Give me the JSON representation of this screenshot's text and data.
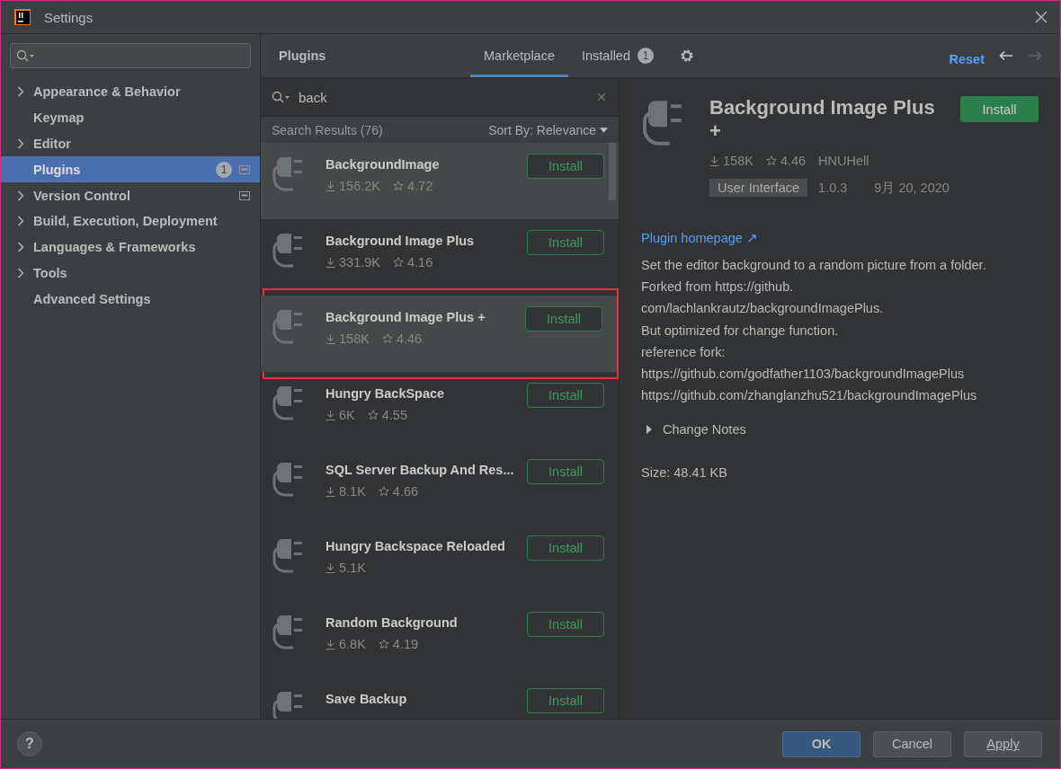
{
  "window": {
    "title": "Settings"
  },
  "sidebar": {
    "items": [
      {
        "label": "Appearance & Behavior",
        "expandable": true,
        "selected": false,
        "project_scope": false
      },
      {
        "label": "Keymap",
        "expandable": false,
        "selected": false,
        "project_scope": false
      },
      {
        "label": "Editor",
        "expandable": true,
        "selected": false,
        "project_scope": false
      },
      {
        "label": "Plugins",
        "expandable": false,
        "selected": true,
        "project_scope": true,
        "badge": "1"
      },
      {
        "label": "Version Control",
        "expandable": true,
        "selected": false,
        "project_scope": true
      },
      {
        "label": "Build, Execution, Deployment",
        "expandable": true,
        "selected": false,
        "project_scope": false
      },
      {
        "label": "Languages & Frameworks",
        "expandable": true,
        "selected": false,
        "project_scope": false
      },
      {
        "label": "Tools",
        "expandable": true,
        "selected": false,
        "project_scope": false
      },
      {
        "label": "Advanced Settings",
        "expandable": false,
        "selected": false,
        "project_scope": false
      }
    ]
  },
  "header": {
    "title": "Plugins",
    "tabs": [
      {
        "label": "Marketplace",
        "selected": true
      },
      {
        "label": "Installed",
        "selected": false,
        "badge": "1"
      }
    ],
    "reset": "Reset"
  },
  "search": {
    "value": "back"
  },
  "results": {
    "summary": "Search Results (76)",
    "sort": "Sort By: Relevance",
    "items": [
      {
        "name": "BackgroundImage",
        "downloads": "156.2K",
        "rating": "4.72",
        "button": "Install",
        "highlighted": true,
        "outlined": false
      },
      {
        "name": "Background Image Plus",
        "downloads": "331.9K",
        "rating": "4.16",
        "button": "Install",
        "highlighted": false,
        "outlined": false
      },
      {
        "name": "Background Image Plus +",
        "downloads": "158K",
        "rating": "4.46",
        "button": "Install",
        "highlighted": true,
        "outlined": true
      },
      {
        "name": "Hungry BackSpace",
        "downloads": "6K",
        "rating": "4.55",
        "button": "Install",
        "highlighted": false,
        "outlined": false
      },
      {
        "name": "SQL Server Backup And Res...",
        "downloads": "8.1K",
        "rating": "4.66",
        "button": "Install",
        "highlighted": false,
        "outlined": false
      },
      {
        "name": "Hungry Backspace Reloaded",
        "downloads": "5.1K",
        "button": "Install",
        "highlighted": false,
        "outlined": false
      },
      {
        "name": "Random Background",
        "downloads": "6.8K",
        "rating": "4.19",
        "button": "Install",
        "highlighted": false,
        "outlined": false
      },
      {
        "name": "Save Backup",
        "button": "Install",
        "highlighted": false,
        "outlined": false
      }
    ]
  },
  "detail": {
    "title": "Background Image Plus",
    "title_wrap": "+",
    "button": "Install",
    "downloads": "158K",
    "rating": "4.46",
    "author": "HNUHell",
    "tag": "User Interface",
    "version": "1.0.3",
    "date": "9月 20, 2020",
    "homepage": "Plugin homepage ↗",
    "description": [
      "Set the editor background to a random picture from a folder.",
      "Forked from https://github.",
      "com/lachlankrautz/backgroundImagePlus.",
      "But optimized for change function.",
      "reference fork:",
      "https://github.com/godfather1103/backgroundImagePlus",
      "https://github.com/zhanglanzhu521/backgroundImagePlus"
    ],
    "change_notes": "Change Notes",
    "size": "Size: 48.41 KB"
  },
  "footer": {
    "help": "?",
    "buttons": [
      {
        "label": "OK",
        "kind": "primary"
      },
      {
        "label": "Cancel",
        "kind": "normal"
      },
      {
        "label": "Apply",
        "kind": "underlined"
      }
    ]
  }
}
